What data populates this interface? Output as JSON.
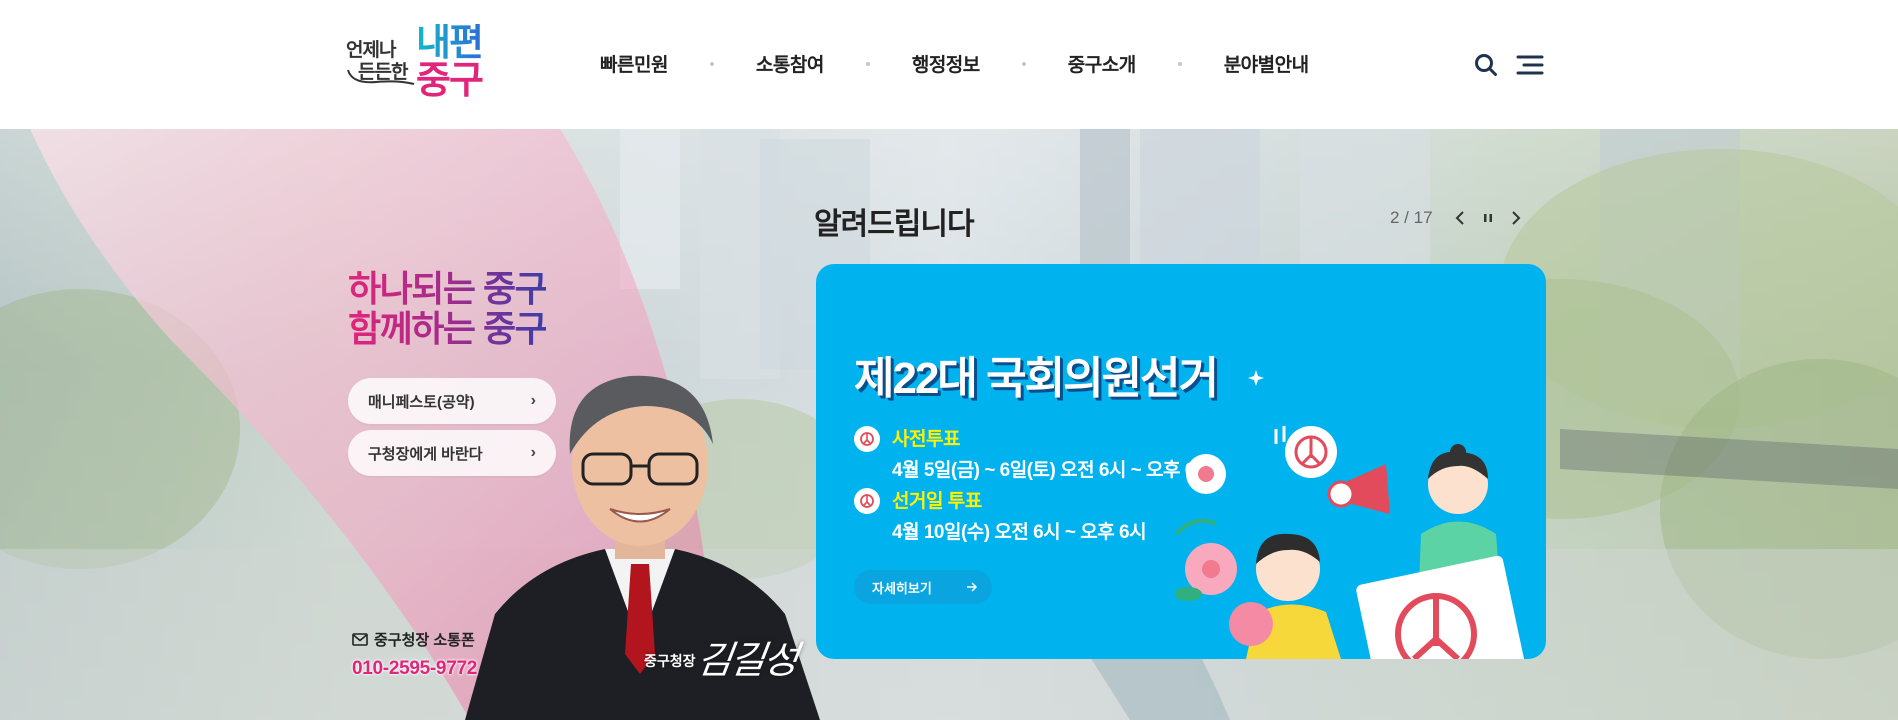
{
  "logo": {
    "sub_line1": "언제나",
    "sub_line2": "든든한",
    "main_line1": "내편",
    "main_line2": "중구"
  },
  "nav": {
    "items": [
      "빠른민원",
      "소통참여",
      "행정정보",
      "중구소개",
      "분야별안내"
    ]
  },
  "header_icons": [
    "search-icon",
    "menu-icon"
  ],
  "hero": {
    "slogan_line1": "하나되는 중구",
    "slogan_line2": "함께하는 중구",
    "links": [
      {
        "label": "매니페스토(공약)"
      },
      {
        "label": "구청장에게 바란다"
      }
    ],
    "sotong_label": "중구청장 소통폰",
    "sotong_phone": "010-2595-9772",
    "mayor_title": "중구청장",
    "mayor_name": "김길성"
  },
  "notice": {
    "title": "알려드립니다",
    "counter": "2 / 17"
  },
  "banner": {
    "title": "제22대 국회의원선거",
    "items": [
      {
        "heading": "사전투표",
        "detail": "4월 5일(금) ~ 6일(토) 오전 6시 ~ 오후 6시"
      },
      {
        "heading": "선거일 투표",
        "detail": "4월 10일(수) 오전 6시 ~ 오후 6시"
      }
    ],
    "more_label": "자세히보기"
  },
  "colors": {
    "brand_pink": "#e0267b",
    "brand_teal": "#14b8c8",
    "banner_blue": "#00b2ee",
    "highlight_yellow": "#fff200"
  }
}
